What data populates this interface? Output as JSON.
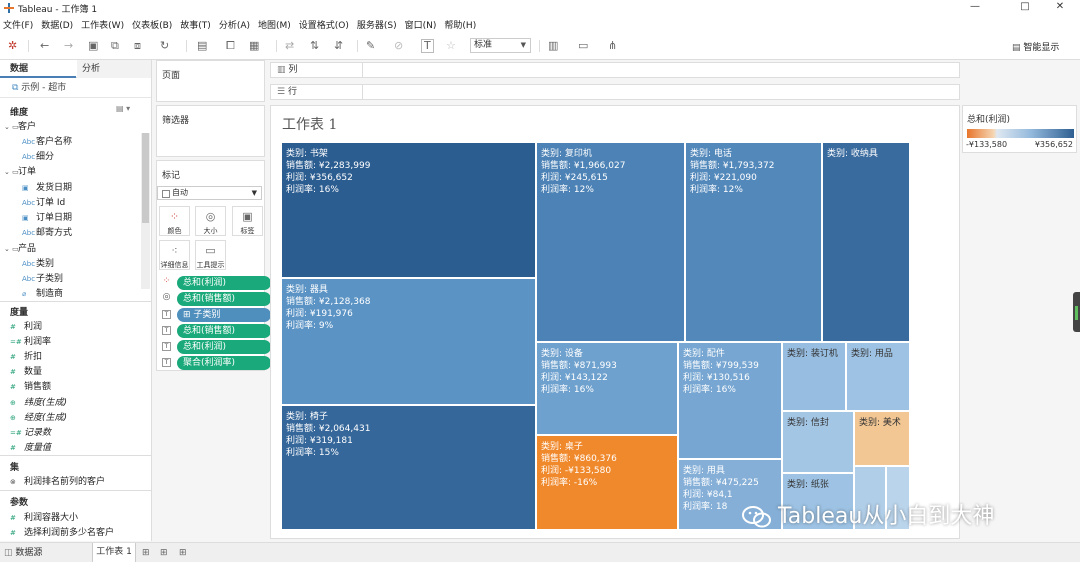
{
  "window": {
    "title": "Tableau - 工作簿 1",
    "minimize": "—",
    "maximize": "□",
    "close": "✕"
  },
  "menu": [
    "文件(F)",
    "数据(D)",
    "工作表(W)",
    "仪表板(B)",
    "故事(T)",
    "分析(A)",
    "地图(M)",
    "设置格式(O)",
    "服务器(S)",
    "窗口(N)",
    "帮助(H)"
  ],
  "toolbar": {
    "fit_select": "标准",
    "smart_display": "智能显示"
  },
  "data_pane": {
    "tab_data": "数据",
    "tab_analysis": "分析",
    "datasource": "示例 - 超市",
    "dimensions_header": "维度",
    "dimensions": [
      {
        "label": "客户",
        "kind": "folder"
      },
      {
        "label": "客户名称",
        "kind": "abc"
      },
      {
        "label": "细分",
        "kind": "abc"
      },
      {
        "label": "订单",
        "kind": "folder"
      },
      {
        "label": "发货日期",
        "kind": "date"
      },
      {
        "label": "订单 Id",
        "kind": "abc"
      },
      {
        "label": "订单日期",
        "kind": "date"
      },
      {
        "label": "邮寄方式",
        "kind": "abc"
      },
      {
        "label": "产品",
        "kind": "folder"
      },
      {
        "label": "类别",
        "kind": "abc"
      },
      {
        "label": "子类别",
        "kind": "abc"
      },
      {
        "label": "制造商",
        "kind": "calc"
      }
    ],
    "measures_header": "度量",
    "measures": [
      "利润",
      "利润率",
      "折扣",
      "数量",
      "销售额",
      "纬度(生成)",
      "经度(生成)",
      "记录数",
      "度量值"
    ],
    "sets_header": "集",
    "sets": [
      "利润排名前列的客户"
    ],
    "params_header": "参数",
    "params": [
      "利润容器大小",
      "选择利润前多少名客户"
    ]
  },
  "pages_card": {
    "title": "页面"
  },
  "filters_card": {
    "title": "筛选器"
  },
  "marks_card": {
    "title": "标记",
    "mark_type": "自动",
    "buttons": [
      "颜色",
      "大小",
      "标签",
      "详细信息",
      "工具提示"
    ],
    "pills": [
      {
        "label": "总和(利润)",
        "kind": "color"
      },
      {
        "label": "总和(销售额)",
        "kind": "size"
      },
      {
        "label": "子类别",
        "kind": "label"
      },
      {
        "label": "总和(销售额)",
        "kind": "label"
      },
      {
        "label": "总和(利润)",
        "kind": "label"
      },
      {
        "label": "聚合(利润率)",
        "kind": "label"
      }
    ]
  },
  "shelves": {
    "columns": "列",
    "rows": "行"
  },
  "view": {
    "title": "工作表 1"
  },
  "legend": {
    "title": "总和(利润)",
    "min": "-¥133,580",
    "max": "¥356,652",
    "color_low": "#e8762c",
    "color_high": "#2e5f91"
  },
  "treemap": [
    {
      "lines": [
        "类别: 书架",
        "销售额: ¥2,283,999",
        "利润: ¥356,652",
        "利润率: 16%"
      ],
      "profit": 356652,
      "color": "#2c5d90"
    },
    {
      "lines": [
        "类别: 器具",
        "销售额: ¥2,128,368",
        "利润: ¥191,976",
        "利润率: 9%"
      ],
      "profit": 191976,
      "color": "#5b93c4"
    },
    {
      "lines": [
        "类别: 椅子",
        "销售额: ¥2,064,431",
        "利润: ¥319,181",
        "利润率: 15%"
      ],
      "profit": 319181,
      "color": "#35679a"
    },
    {
      "lines": [
        "类别: 复印机",
        "销售额: ¥1,966,027",
        "利润: ¥245,615",
        "利润率: 12%"
      ],
      "profit": 245615,
      "color": "#4c82b5"
    },
    {
      "lines": [
        "类别: 电话",
        "销售额: ¥1,793,372",
        "利润: ¥221,090",
        "利润率: 12%"
      ],
      "profit": 221090,
      "color": "#5388bb"
    },
    {
      "lines": [
        "类别: 收纳具"
      ],
      "profit": null,
      "color": "#3a6b9e"
    },
    {
      "lines": [
        "类别: 设备",
        "销售额: ¥871,993",
        "利润: ¥143,122",
        "利润率: 16%"
      ],
      "profit": 143122,
      "color": "#6fa1ce"
    },
    {
      "lines": [
        "类别: 配件",
        "销售额: ¥799,539",
        "利润: ¥130,516",
        "利润率: 16%"
      ],
      "profit": 130516,
      "color": "#76a6d1"
    },
    {
      "lines": [
        "类别: 装订机"
      ],
      "profit": null,
      "color": "#97bde0"
    },
    {
      "lines": [
        "类别: 用品"
      ],
      "profit": null,
      "color": "#9ec2e3"
    },
    {
      "lines": [
        "类别: 桌子",
        "销售额: ¥860,376",
        "利润: -¥133,580",
        "利润率: -16%"
      ],
      "profit": -133580,
      "color": "#f0892c"
    },
    {
      "lines": [
        "类别: 信封"
      ],
      "profit": null,
      "color": "#a4c6e5"
    },
    {
      "lines": [
        "类别: 美术"
      ],
      "profit": null,
      "color": "#f2c794"
    },
    {
      "lines": [
        "类别: 用具",
        "销售额: ¥475,225",
        "利润: ¥84,1",
        "利润率: 18"
      ],
      "profit": null,
      "color": "#85afd7"
    },
    {
      "lines": [
        "类别: 纸张"
      ],
      "profit": null,
      "color": "#9dc2e3"
    },
    {
      "lines": [],
      "profit": null,
      "color": "#b1cee8"
    },
    {
      "lines": [],
      "profit": null,
      "color": "#bad4eb"
    }
  ],
  "statusbar": {
    "datasource": "数据源",
    "sheet": "工作表 1"
  },
  "watermark": "Tableau从小白到大神"
}
